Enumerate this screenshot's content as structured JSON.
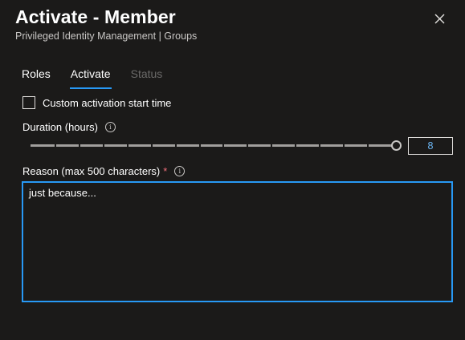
{
  "header": {
    "title": "Activate - Member",
    "subtitle": "Privileged Identity Management | Groups",
    "close_icon": "close-icon"
  },
  "tabs": [
    {
      "label": "Roles",
      "state": "normal"
    },
    {
      "label": "Activate",
      "state": "active"
    },
    {
      "label": "Status",
      "state": "disabled"
    }
  ],
  "custom_start": {
    "label": "Custom activation start time",
    "checked": false
  },
  "duration": {
    "label": "Duration (hours)",
    "info_icon": "info-icon",
    "value": "8",
    "slider_fraction": 1.0
  },
  "reason": {
    "label": "Reason (max 500 characters)",
    "required_mark": "*",
    "info_icon": "info-icon",
    "value": "just because..."
  },
  "colors": {
    "accent": "#2899f5",
    "required": "#f1707b",
    "background": "#1b1a19"
  }
}
